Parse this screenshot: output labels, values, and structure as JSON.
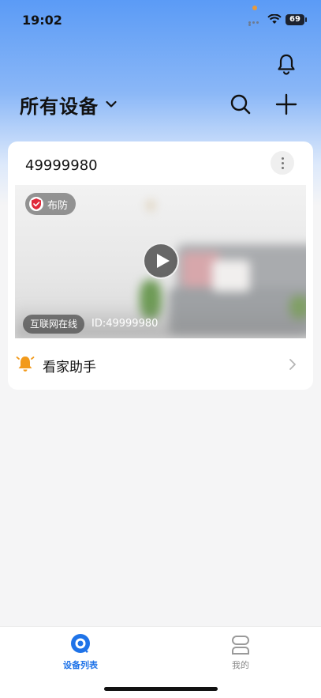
{
  "status_bar": {
    "time": "19:02",
    "battery": "69"
  },
  "header": {
    "title": "所有设备",
    "icons": [
      "bell-icon",
      "chevron-down-icon",
      "search-icon",
      "plus-icon"
    ]
  },
  "device_card": {
    "name": "49999980",
    "arm_status": "布防",
    "connection_status": "互联网在线",
    "device_id": "ID:49999980",
    "assistant_label": "看家助手"
  },
  "tab_bar": {
    "tabs": [
      {
        "label": "设备列表",
        "active": true
      },
      {
        "label": "我的",
        "active": false
      }
    ]
  },
  "colors": {
    "accent": "#1f73e8",
    "header_gradient_top": "#5b9bf6",
    "arm_shield": "#e0283a",
    "assistant_bell": "#f29a1b"
  }
}
